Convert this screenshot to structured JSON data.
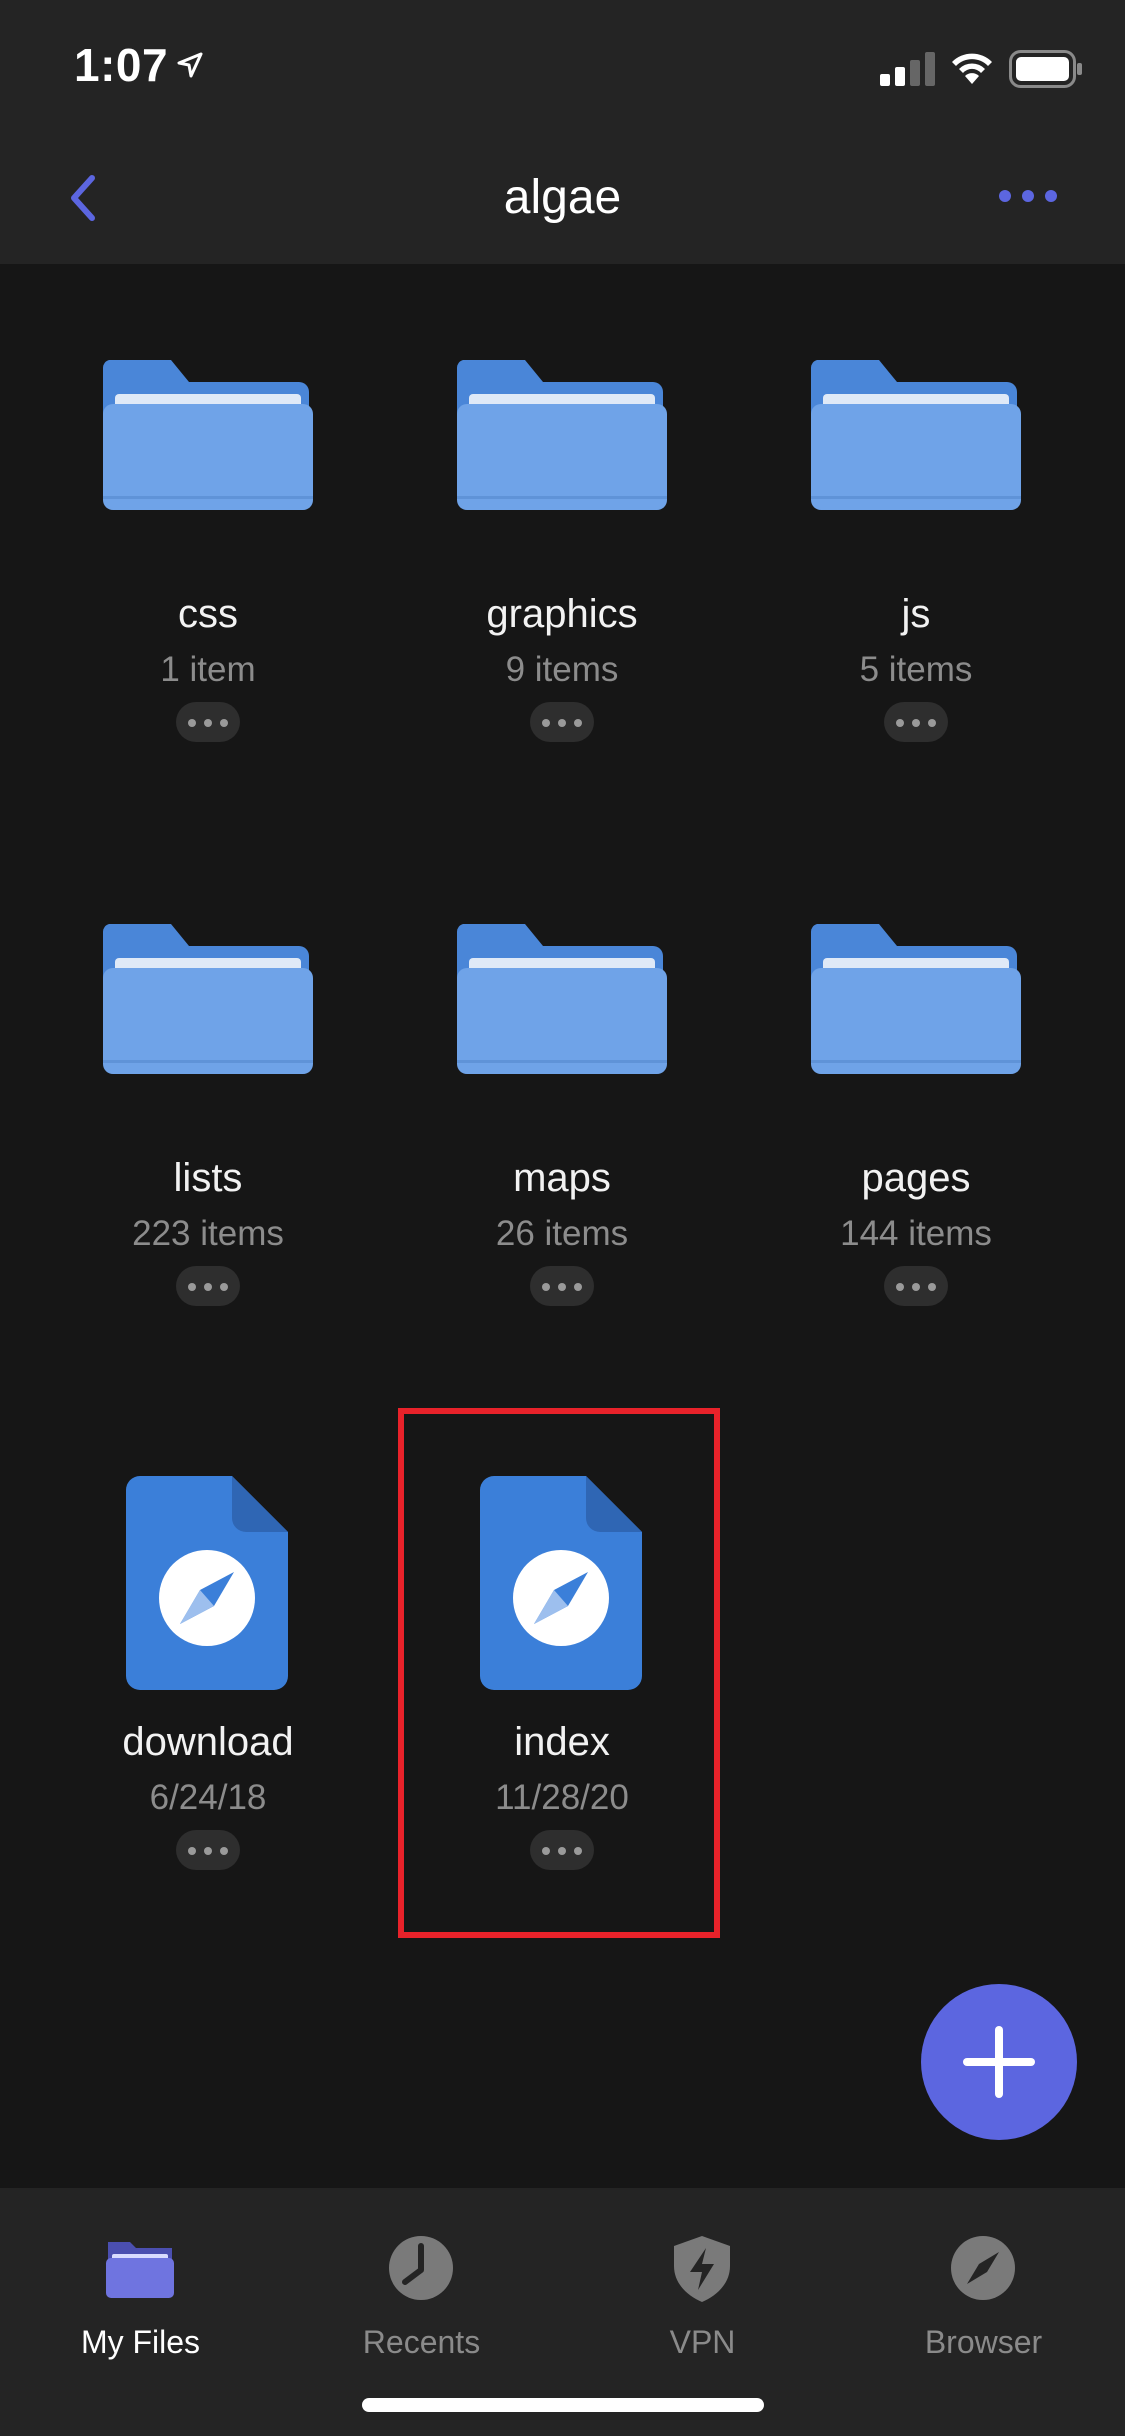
{
  "status_bar": {
    "time": "1:07"
  },
  "header": {
    "title": "algae",
    "accent_color": "#5c66e0"
  },
  "items": [
    {
      "name": "css",
      "meta": "1 item",
      "kind": "folder"
    },
    {
      "name": "graphics",
      "meta": "9 items",
      "kind": "folder"
    },
    {
      "name": "js",
      "meta": "5 items",
      "kind": "folder"
    },
    {
      "name": "lists",
      "meta": "223 items",
      "kind": "folder"
    },
    {
      "name": "maps",
      "meta": "26 items",
      "kind": "folder"
    },
    {
      "name": "pages",
      "meta": "144 items",
      "kind": "folder"
    },
    {
      "name": "download",
      "meta": "6/24/18",
      "kind": "web-file"
    },
    {
      "name": "index",
      "meta": "11/28/20",
      "kind": "web-file",
      "highlighted": true
    }
  ],
  "tabs": [
    {
      "label": "My Files",
      "icon": "folder-icon",
      "active": true
    },
    {
      "label": "Recents",
      "icon": "clock-icon",
      "active": false
    },
    {
      "label": "VPN",
      "icon": "shield-bolt-icon",
      "active": false
    },
    {
      "label": "Browser",
      "icon": "compass-icon",
      "active": false
    }
  ],
  "fab": {
    "icon": "plus-icon"
  },
  "colors": {
    "folder_blue": "#6fa3e8",
    "file_blue": "#3b7fd9",
    "highlight_red": "#e8222a"
  }
}
